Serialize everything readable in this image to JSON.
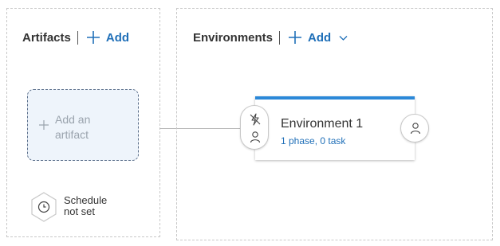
{
  "artifacts": {
    "title": "Artifacts",
    "add_label": "Add",
    "add_artifact_label": "Add an artifact",
    "schedule_label": "Schedule not set"
  },
  "environments": {
    "title": "Environments",
    "add_label": "Add",
    "cards": [
      {
        "name": "Environment 1",
        "summary": "1 phase, 0 task"
      }
    ]
  },
  "colors": {
    "accent": "#1f6fb8",
    "card_top_border": "#2b88d8",
    "artifact_box_bg": "#eef4fb"
  },
  "icons": {
    "add": "plus-icon",
    "dropdown": "chevron-down-icon",
    "schedule": "clock-icon",
    "trigger": "lightning-icon",
    "approver": "person-icon"
  }
}
